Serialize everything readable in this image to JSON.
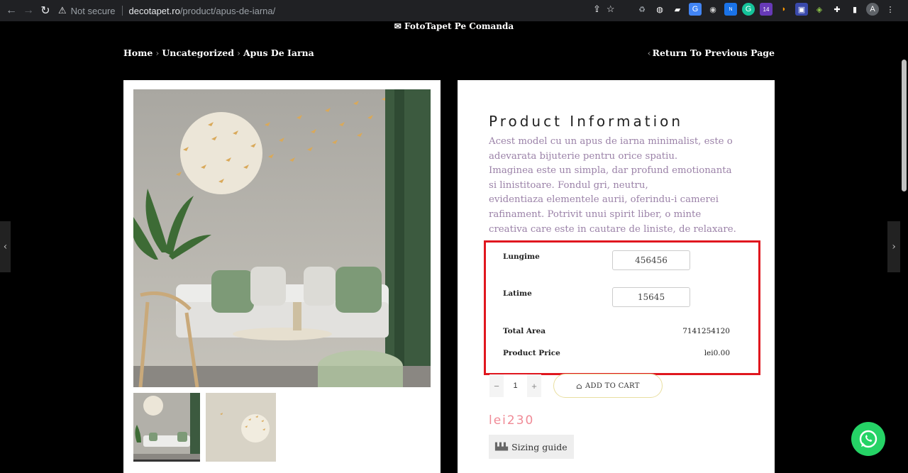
{
  "browser": {
    "security_label": "Not secure",
    "url_domain": "decotapet.ro",
    "url_path": "/product/apus-de-iarna/"
  },
  "page": {
    "top_banner": "FotoTapet Pe Comanda",
    "breadcrumb": [
      "Home",
      "Uncategorized",
      "Apus De Iarna"
    ],
    "return_link": "Return To Previous Page"
  },
  "product": {
    "info_title": "Product Information",
    "description": [
      "Acest model cu un apus de iarna minimalist, este o adevarata bijuterie pentru orice spatiu.",
      "Imaginea este un simpla, dar profund emotionanta si linistitoare. Fondul gri, neutru,",
      "evidentiaza elementele aurii, oferindu-i camerei rafinament. Potrivit unui spirit liber, o minte creativa care este in cautare de liniste, de relaxare."
    ],
    "calculator": {
      "length_label": "Lungime",
      "length_value": "456456",
      "width_label": "Latime",
      "width_value": "15645",
      "total_area_label": "Total Area",
      "total_area_value": "7141254120",
      "price_label": "Product Price",
      "price_value": "lei0.00"
    },
    "quantity": "1",
    "qty_minus": "−",
    "qty_plus": "+",
    "add_to_cart": "ADD TO CART",
    "price": "lei230",
    "sizing_guide": "Sizing guide"
  },
  "colors": {
    "description_text": "#9b82a8",
    "price": "#f08a96",
    "highlight_box": "#e0171f",
    "whatsapp": "#25d366"
  }
}
